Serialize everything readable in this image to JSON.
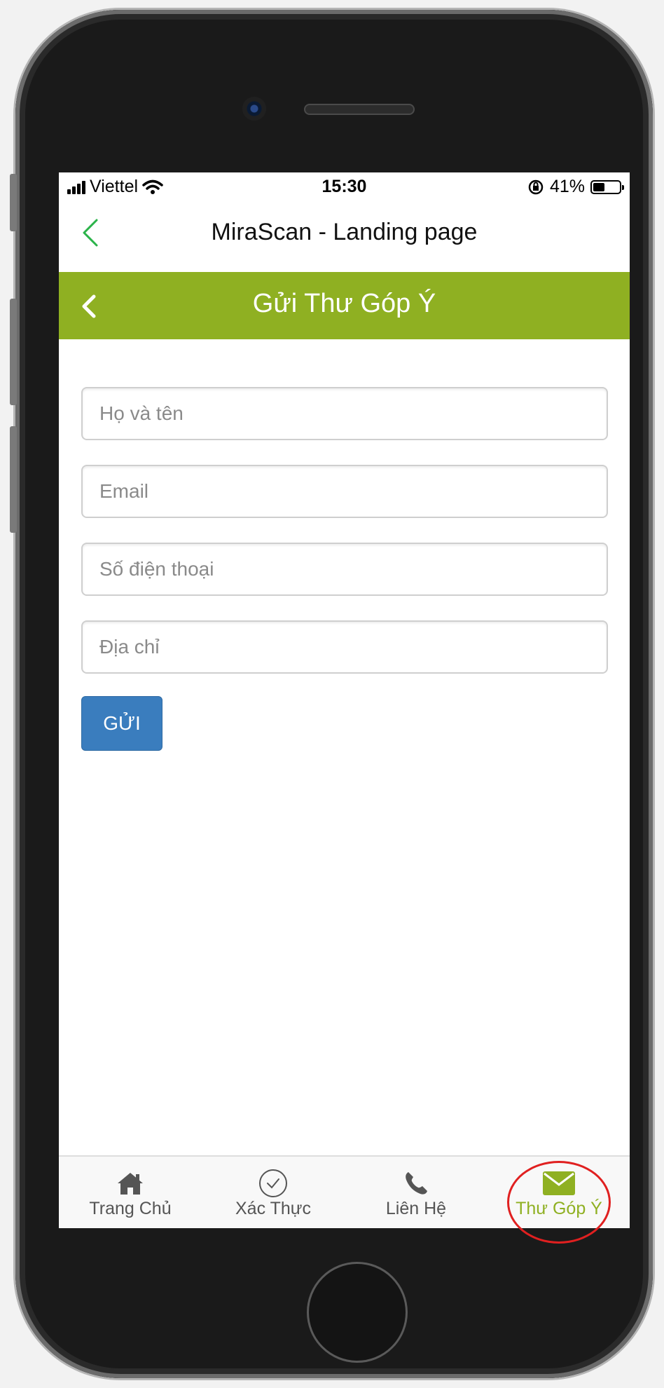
{
  "status_bar": {
    "carrier": "Viettel",
    "time": "15:30",
    "battery": "41%"
  },
  "nav": {
    "title": "MiraScan - Landing page"
  },
  "page": {
    "title": "Gửi Thư Góp Ý"
  },
  "form": {
    "name_placeholder": "Họ và tên",
    "email_placeholder": "Email",
    "phone_placeholder": "Số điện thoại",
    "address_placeholder": "Địa chỉ",
    "submit_label": "GỬI"
  },
  "tabs": [
    {
      "label": "Trang Chủ",
      "icon": "home-icon"
    },
    {
      "label": "Xác Thực",
      "icon": "check-circle-icon"
    },
    {
      "label": "Liên Hệ",
      "icon": "phone-icon"
    },
    {
      "label": "Thư Góp Ý",
      "icon": "envelope-icon",
      "active": true
    }
  ],
  "colors": {
    "accent": "#8fb022",
    "button": "#3a7dbe",
    "highlight": "#e02020"
  }
}
